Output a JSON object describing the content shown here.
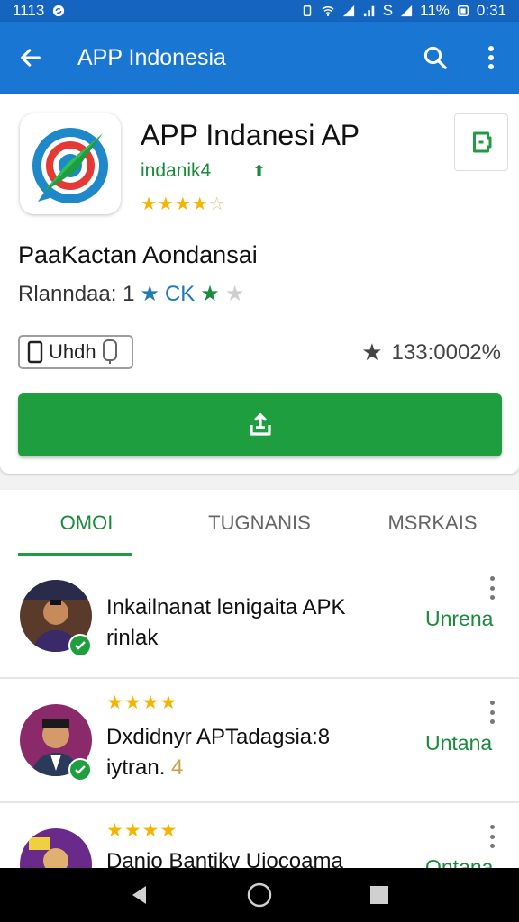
{
  "status_bar": {
    "time": "1113",
    "battery": "11%",
    "clock_right": "0:31",
    "carrier": "S"
  },
  "app_bar": {
    "title": "APP Indonesia"
  },
  "app": {
    "name": "APP Indanesi AP",
    "developer": "indanik4",
    "rating_stars": 4,
    "subtitle": "PaaKactan Aondansai",
    "rating_label": "Rlanndaa: 1",
    "rating_suffix": "CK",
    "device_label": "Uhdh",
    "score": "133:0002%"
  },
  "tabs": [
    {
      "label": "OMOI",
      "active": true
    },
    {
      "label": "TUGNANIS",
      "active": false
    },
    {
      "label": "MSRKAIS",
      "active": false
    }
  ],
  "list": [
    {
      "title": "Inkailnanat lenigaita APK",
      "title2": "rinlak",
      "action": "Unrena",
      "stars": ""
    },
    {
      "title": "Dxdidnyr APTadagsia:8",
      "title2": "iytran.",
      "title2_extra": "4",
      "action": "Untana",
      "stars": "★★★★"
    },
    {
      "title": "Danio Bantiky Uiocoama",
      "title2": "",
      "action": "Ontana",
      "stars": "★★★★"
    }
  ],
  "colors": {
    "primary": "#1976d2",
    "accent_green": "#1e9e3e",
    "star": "#f5b400"
  }
}
